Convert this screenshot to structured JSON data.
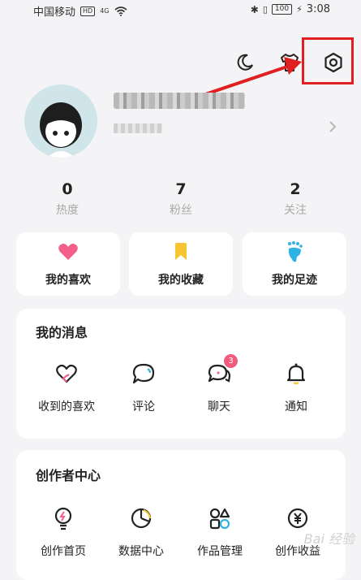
{
  "status_bar": {
    "carrier": "中国移动",
    "hd": "HD",
    "signal_label": "4G",
    "battery": "100",
    "time": "3:08"
  },
  "stats": [
    {
      "count": "0",
      "label": "热度"
    },
    {
      "count": "7",
      "label": "粉丝"
    },
    {
      "count": "2",
      "label": "关注"
    }
  ],
  "quick_cards": [
    {
      "label": "我的喜欢",
      "icon": "heart-icon",
      "color": "#f2608a"
    },
    {
      "label": "我的收藏",
      "icon": "bookmark-icon",
      "color": "#f7c531"
    },
    {
      "label": "我的足迹",
      "icon": "footprint-icon",
      "color": "#2fb3e4"
    }
  ],
  "messages": {
    "title": "我的消息",
    "items": [
      {
        "label": "收到的喜欢",
        "icon": "heart-outline-icon"
      },
      {
        "label": "评论",
        "icon": "comment-icon"
      },
      {
        "label": "聊天",
        "icon": "chat-icon",
        "badge": "3"
      },
      {
        "label": "通知",
        "icon": "bell-icon"
      }
    ]
  },
  "creator": {
    "title": "创作者中心",
    "items": [
      {
        "label": "创作首页",
        "icon": "bulb-icon"
      },
      {
        "label": "数据中心",
        "icon": "pie-chart-icon"
      },
      {
        "label": "作品管理",
        "icon": "grid-shapes-icon"
      },
      {
        "label": "创作收益",
        "icon": "yuan-coin-icon"
      }
    ]
  },
  "watermark": "Bai 经验",
  "colors": {
    "accent_red": "#e02020",
    "badge": "#f05b7e"
  }
}
